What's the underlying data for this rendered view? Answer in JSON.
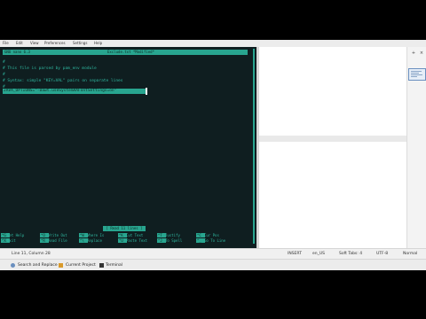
{
  "menu": [
    "File",
    "Edit",
    "View",
    "Preferences",
    "Settings",
    "Help"
  ],
  "terminal": {
    "title_left": "GNU nano 6.3",
    "title_center": "Exclude.txt *Modified*",
    "lines": [
      "#",
      "# This file is parsed by pam_env module",
      "#",
      "# Syntax: simple \"KEY=VAL\" pairs on separate lines",
      "#"
    ],
    "highlight_line": "JAVA_OPTIONS=\"-Dawt.useSystemAAFontSettings=on\"",
    "status_message": "[ Read 11 lines ]",
    "shortcuts": [
      {
        "key": "^G",
        "label": "Get Help"
      },
      {
        "key": "^O",
        "label": "Write Out"
      },
      {
        "key": "^W",
        "label": "Where Is"
      },
      {
        "key": "^K",
        "label": "Cut Text"
      },
      {
        "key": "^T",
        "label": "Justify"
      },
      {
        "key": "^C",
        "label": "Cur Pos"
      },
      {
        "key": "^X",
        "label": "Exit"
      },
      {
        "key": "^R",
        "label": "Read File"
      },
      {
        "key": "^\\",
        "label": "Replace"
      },
      {
        "key": "^U",
        "label": "Paste Text"
      },
      {
        "key": "^J",
        "label": "To Spell"
      },
      {
        "key": "^_",
        "label": "Go To Line"
      }
    ]
  },
  "statusbar": {
    "position": "Line 11, Column 28",
    "mode": "INSERT",
    "language": "en_US",
    "tabs": "Soft Tabs: 4",
    "encoding": "UTF-8",
    "style": "Normal"
  },
  "panels": [
    {
      "label": "Search and Replace",
      "icon": "search-icon",
      "color": "#6a8fbf"
    },
    {
      "label": "Current Project",
      "icon": "folder-icon",
      "color": "#d99a2b"
    },
    {
      "label": "Terminal",
      "icon": "terminal-icon",
      "color": "#333333"
    }
  ],
  "sidebar": {
    "plus": "+",
    "cross": "×"
  },
  "colors": {
    "accent": "#28a58f",
    "terminal_bg": "#0f1e20",
    "terminal_text": "#2fb8a0"
  }
}
